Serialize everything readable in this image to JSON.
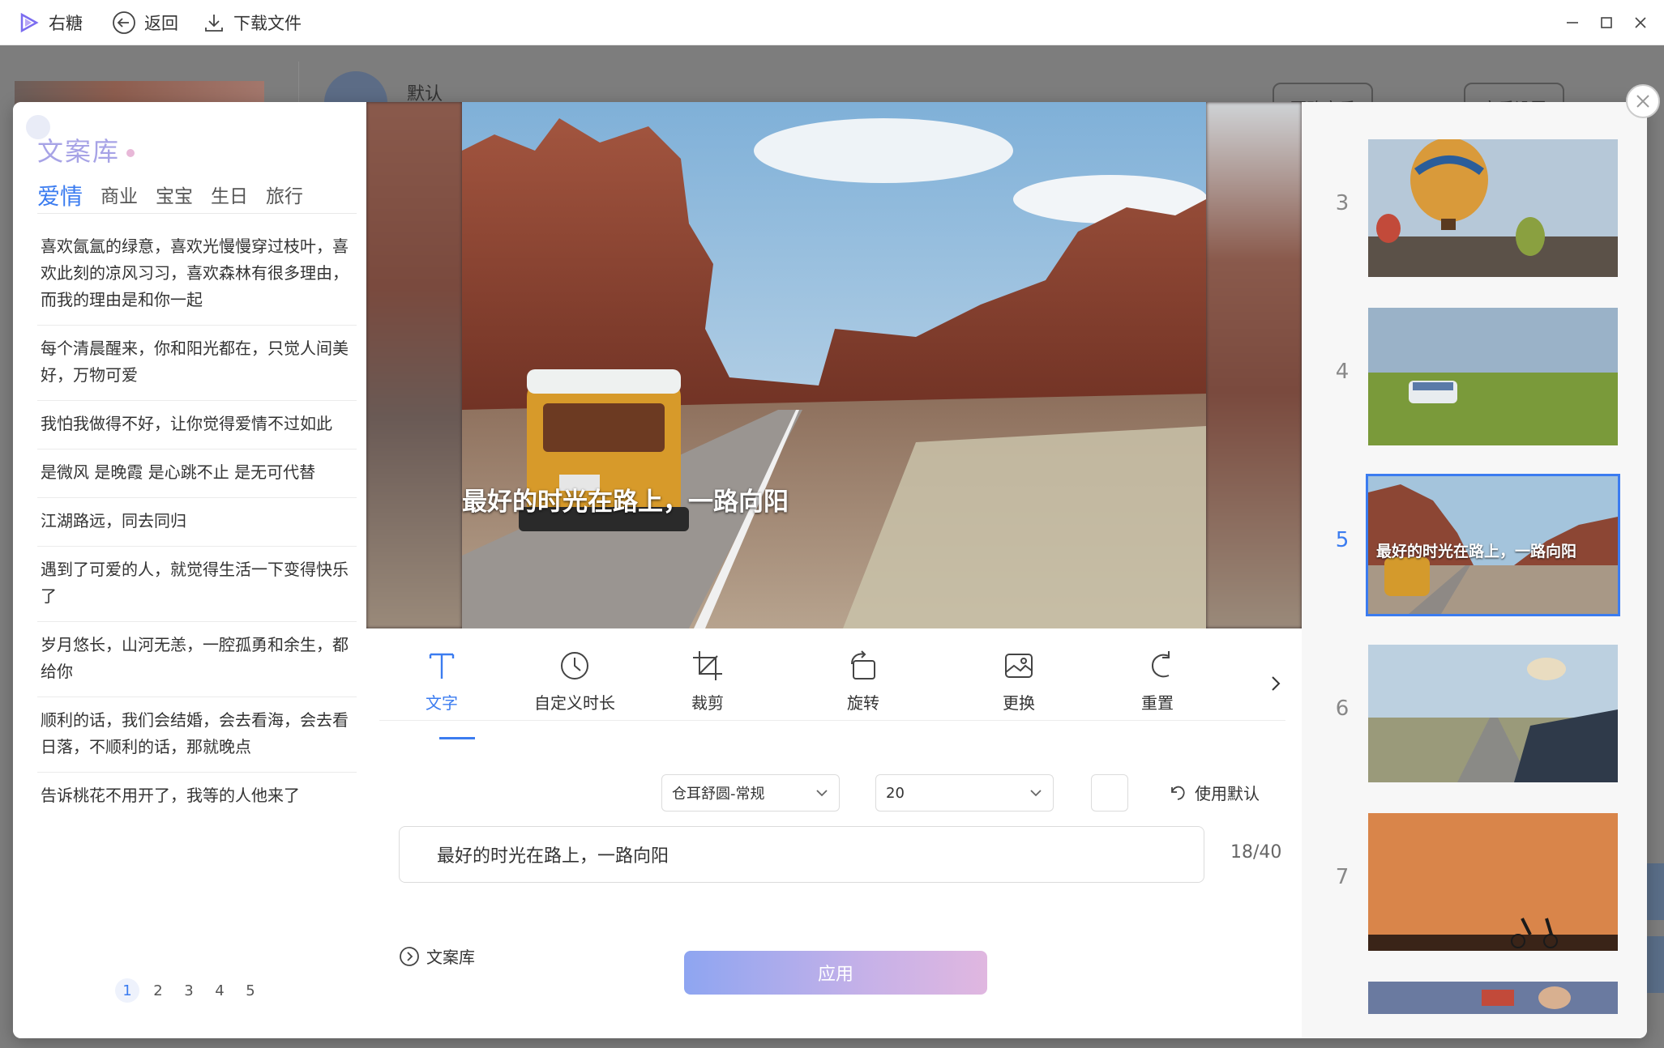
{
  "titlebar": {
    "app_name": "右糖",
    "back_label": "返回",
    "download_label": "下载文件"
  },
  "background": {
    "title": "默认",
    "btn_change_music": "更改音乐",
    "btn_music_settings": "音乐设置"
  },
  "library": {
    "title": "文案库",
    "tabs": [
      "爱情",
      "商业",
      "宝宝",
      "生日",
      "旅行"
    ],
    "active_tab": "爱情",
    "items": [
      "喜欢氤氲的绿意，喜欢光慢慢穿过枝叶，喜欢此刻的凉风习习，喜欢森林有很多理由，而我的理由是和你一起",
      "每个清晨醒来，你和阳光都在，只觉人间美好，万物可爱",
      "我怕我做得不好，让你觉得爱情不过如此",
      "是微风 是晚霞 是心跳不止 是无可代替",
      "江湖路远，同去同归",
      "遇到了可爱的人，就觉得生活一下变得快乐了",
      "岁月悠长，山河无恙，一腔孤勇和余生，都给你",
      "顺利的话，我们会结婚，会去看海，会去看日落，不顺利的话，那就晚点",
      "告诉桃花不用开了，我等的人他来了"
    ],
    "pages": [
      "1",
      "2",
      "3",
      "4",
      "5"
    ],
    "active_page": "1"
  },
  "editor": {
    "caption": "最好的时光在路上，一路向阳",
    "tools": [
      {
        "label": "文字",
        "icon": "text-icon"
      },
      {
        "label": "自定义时长",
        "icon": "clock-icon"
      },
      {
        "label": "裁剪",
        "icon": "crop-icon"
      },
      {
        "label": "旋转",
        "icon": "rotate-icon"
      },
      {
        "label": "更换",
        "icon": "replace-image-icon"
      },
      {
        "label": "重置",
        "icon": "reset-icon"
      }
    ],
    "active_tool": "文字",
    "font_select": "仓耳舒圆-常规",
    "size_select": "20",
    "use_default_label": "使用默认",
    "text_value": "最好的时光在路上，一路向阳",
    "char_count": "18/40",
    "library_link": "文案库",
    "apply_label": "应用"
  },
  "slides": {
    "items": [
      {
        "num": "3",
        "caption": ""
      },
      {
        "num": "4",
        "caption": ""
      },
      {
        "num": "5",
        "caption": "最好的时光在路上，一路向阳"
      },
      {
        "num": "6",
        "caption": ""
      },
      {
        "num": "7",
        "caption": ""
      }
    ],
    "active": "5"
  },
  "colors": {
    "accent": "#3b7cf0",
    "library_title": "#a7a3e6",
    "apply_gradient_start": "#8ea5f1",
    "apply_gradient_end": "#e0b7e0"
  }
}
